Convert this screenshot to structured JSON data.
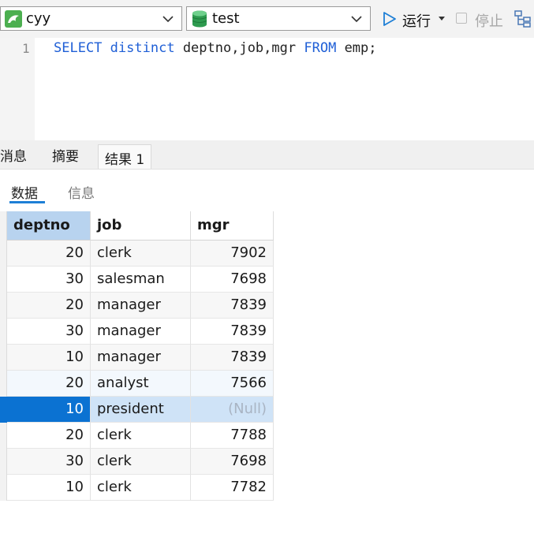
{
  "toolbar": {
    "connection": "cyy",
    "database": "test",
    "run_label": "运行",
    "stop_label": "停止"
  },
  "editor": {
    "line_number": "1",
    "sql": {
      "kw1": "SELECT",
      "kw2": "distinct",
      "cols": "deptno,job,mgr",
      "kw3": "FROM",
      "table": "emp;"
    }
  },
  "result_tabs": [
    "消息",
    "摘要",
    "结果 1"
  ],
  "sub_tabs": [
    "数据",
    "信息"
  ],
  "grid": {
    "columns": [
      "deptno",
      "job",
      "mgr"
    ],
    "rows": [
      {
        "deptno": "20",
        "job": "clerk",
        "mgr": "7902"
      },
      {
        "deptno": "30",
        "job": "salesman",
        "mgr": "7698"
      },
      {
        "deptno": "20",
        "job": "manager",
        "mgr": "7839"
      },
      {
        "deptno": "30",
        "job": "manager",
        "mgr": "7839"
      },
      {
        "deptno": "10",
        "job": "manager",
        "mgr": "7839"
      },
      {
        "deptno": "20",
        "job": "analyst",
        "mgr": "7566"
      },
      {
        "deptno": "10",
        "job": "president",
        "mgr": "(Null)"
      },
      {
        "deptno": "20",
        "job": "clerk",
        "mgr": "7788"
      },
      {
        "deptno": "30",
        "job": "clerk",
        "mgr": "7698"
      },
      {
        "deptno": "10",
        "job": "clerk",
        "mgr": "7782"
      }
    ]
  },
  "colors": {
    "keyword": "#1f5fd6",
    "selected_cell": "#0b72d2",
    "selected_row": "#cfe3f7",
    "header_selected": "#b8d3ef",
    "null_text": "#a9b4c3"
  }
}
